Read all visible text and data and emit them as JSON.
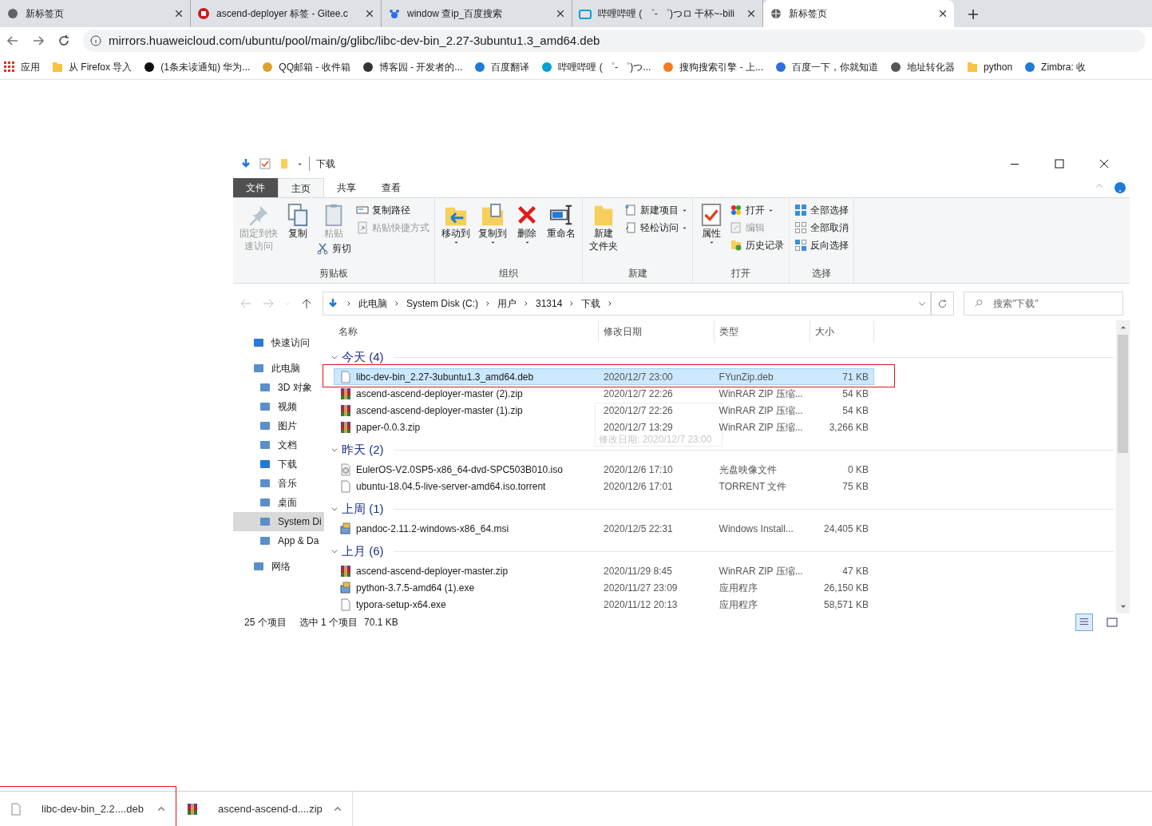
{
  "browser": {
    "tabs": [
      {
        "title": "新标签页",
        "selected": false
      },
      {
        "title": "ascend-deployer 标签 - Gitee.c",
        "selected": false
      },
      {
        "title": "window 查ip_百度搜索",
        "selected": false
      },
      {
        "title": "哔哩哔哩 ( ゜- ゜)つロ 干杯~-bili",
        "selected": false
      },
      {
        "title": "新标签页",
        "selected": true
      }
    ],
    "address": "mirrors.huaweicloud.com/ubuntu/pool/main/g/glibc/libc-dev-bin_2.27-3ubuntu1.3_amd64.deb",
    "bookmarks": [
      "应用",
      "从 Firefox 导入",
      "(1条未读通知) 华为...",
      "QQ邮箱 - 收件箱",
      "博客园 - 开发者的...",
      "百度翻译",
      "哔哩哔哩 ( ゜- ゜)つ...",
      "搜狗搜索引擎 - 上...",
      "百度一下，你就知道",
      "地址转化器",
      "python",
      "Zimbra: 收"
    ]
  },
  "explorer": {
    "title": "下载",
    "ribbon_tabs": [
      {
        "label": "文件",
        "kind": "menu",
        "selected": false
      },
      {
        "label": "主页",
        "kind": "tab",
        "selected": true
      },
      {
        "label": "共享",
        "kind": "tab",
        "selected": false
      },
      {
        "label": "查看",
        "kind": "tab",
        "selected": false
      }
    ],
    "groups": [
      {
        "label": "剪贴板",
        "columns": [
          {
            "kind": "large",
            "lines": [
              "固定到快",
              "速访问"
            ],
            "disabled": true
          },
          {
            "kind": "large",
            "lines": [
              "复制"
            ],
            "disabled": false
          },
          {
            "kind": "large",
            "lines": [
              "粘贴"
            ],
            "disabled": true,
            "below": {
              "label": "剪切",
              "disabled": false
            }
          },
          {
            "kind": "stack",
            "items": [
              {
                "label": "复制路径",
                "disabled": false
              },
              {
                "label": "粘贴快捷方式",
                "disabled": true
              }
            ]
          }
        ]
      },
      {
        "label": "组织",
        "columns": [
          {
            "kind": "large",
            "lines": [
              "移动到"
            ],
            "disabled": false,
            "caret": true
          },
          {
            "kind": "large",
            "lines": [
              "复制到"
            ],
            "disabled": false,
            "caret": true
          },
          {
            "kind": "large",
            "lines": [
              "删除"
            ],
            "disabled": false,
            "caret": true
          },
          {
            "kind": "large",
            "lines": [
              "重命名"
            ],
            "disabled": false
          }
        ]
      },
      {
        "label": "新建",
        "columns": [
          {
            "kind": "large",
            "lines": [
              "新建",
              "文件夹"
            ],
            "disabled": false
          },
          {
            "kind": "stack",
            "items": [
              {
                "label": "新建项目",
                "disabled": false,
                "caret": true
              },
              {
                "label": "轻松访问",
                "disabled": false,
                "caret": true
              }
            ]
          }
        ]
      },
      {
        "label": "打开",
        "columns": [
          {
            "kind": "large",
            "lines": [
              "属性"
            ],
            "disabled": false,
            "caret": true
          },
          {
            "kind": "stack",
            "items": [
              {
                "label": "打开",
                "disabled": false,
                "caret": true
              },
              {
                "label": "编辑",
                "disabled": true
              },
              {
                "label": "历史记录",
                "disabled": false
              }
            ]
          }
        ]
      },
      {
        "label": "选择",
        "columns": [
          {
            "kind": "stack",
            "items": [
              {
                "label": "全部选择",
                "disabled": false
              },
              {
                "label": "全部取消",
                "disabled": false
              },
              {
                "label": "反向选择",
                "disabled": false
              }
            ]
          }
        ]
      }
    ],
    "path": [
      "此电脑",
      "System Disk (C:)",
      "用户",
      "31314",
      "下载"
    ],
    "search": {
      "placeholder": "搜索\"下载\""
    },
    "nav": [
      {
        "label": "快速访问",
        "selected": false
      },
      {
        "label": "此电脑",
        "selected": false,
        "children": [
          {
            "label": "3D 对象",
            "selected": false
          },
          {
            "label": "视频",
            "selected": false
          },
          {
            "label": "图片",
            "selected": false
          },
          {
            "label": "文档",
            "selected": false
          },
          {
            "label": "下载",
            "selected": false
          },
          {
            "label": "音乐",
            "selected": false
          },
          {
            "label": "桌面",
            "selected": false
          },
          {
            "label": "System Di",
            "selected": true
          },
          {
            "label": "App & Da",
            "selected": false
          }
        ]
      },
      {
        "label": "网络",
        "selected": false
      }
    ],
    "columns": [
      "名称",
      "修改日期",
      "类型",
      "大小"
    ],
    "file_groups": [
      {
        "label": "今天 (4)",
        "files": [
          {
            "name": "libc-dev-bin_2.27-3ubuntu1.3_amd64.deb",
            "date": "2020/12/7 23:00",
            "type": "FYunZip.deb",
            "size": "71 KB",
            "kind": "doc",
            "selected": true
          },
          {
            "name": "ascend-ascend-deployer-master (2).zip",
            "date": "2020/12/7 22:26",
            "type": "WinRAR ZIP 压缩...",
            "size": "54 KB",
            "kind": "rar",
            "selected": false
          },
          {
            "name": "ascend-ascend-deployer-master (1).zip",
            "date": "2020/12/7 22:26",
            "type": "WinRAR ZIP 压缩...",
            "size": "54 KB",
            "kind": "rar",
            "selected": false
          },
          {
            "name": "paper-0.0.3.zip",
            "date": "2020/12/7 13:29",
            "type": "WinRAR ZIP 压缩...",
            "size": "3,266 KB",
            "kind": "rar",
            "selected": false
          }
        ]
      },
      {
        "label": "昨天 (2)",
        "files": [
          {
            "name": "EulerOS-V2.0SP5-x86_64-dvd-SPC503B010.iso",
            "date": "2020/12/6 17:10",
            "type": "光盘映像文件",
            "size": "0 KB",
            "kind": "disc",
            "selected": false
          },
          {
            "name": "ubuntu-18.04.5-live-server-amd64.iso.torrent",
            "date": "2020/12/6 17:01",
            "type": "TORRENT 文件",
            "size": "75 KB",
            "kind": "doc",
            "selected": false
          }
        ]
      },
      {
        "label": "上周 (1)",
        "files": [
          {
            "name": "pandoc-2.11.2-windows-x86_64.msi",
            "date": "2020/12/5 22:31",
            "type": "Windows Install...",
            "size": "24,405 KB",
            "kind": "installer",
            "selected": false
          }
        ]
      },
      {
        "label": "上月 (6)",
        "files": [
          {
            "name": "ascend-ascend-deployer-master.zip",
            "date": "2020/11/29 8:45",
            "type": "WinRAR ZIP 压缩...",
            "size": "47 KB",
            "kind": "rar",
            "selected": false
          },
          {
            "name": "python-3.7.5-amd64 (1).exe",
            "date": "2020/11/27 23:09",
            "type": "应用程序",
            "size": "26,150 KB",
            "kind": "installer",
            "selected": false
          },
          {
            "name": "typora-setup-x64.exe",
            "date": "2020/11/12 20:13",
            "type": "应用程序",
            "size": "58,571 KB",
            "kind": "doc",
            "selected": false
          }
        ]
      }
    ],
    "tooltip": "修改日期: 2020/12/7 23:00",
    "status": [
      "25 个项目",
      "选中 1 个项目",
      "70.1 KB"
    ]
  },
  "downloads": [
    {
      "name": "libc-dev-bin_2.2....deb",
      "kind": "doc"
    },
    {
      "name": "ascend-ascend-d....zip",
      "kind": "rar"
    }
  ]
}
